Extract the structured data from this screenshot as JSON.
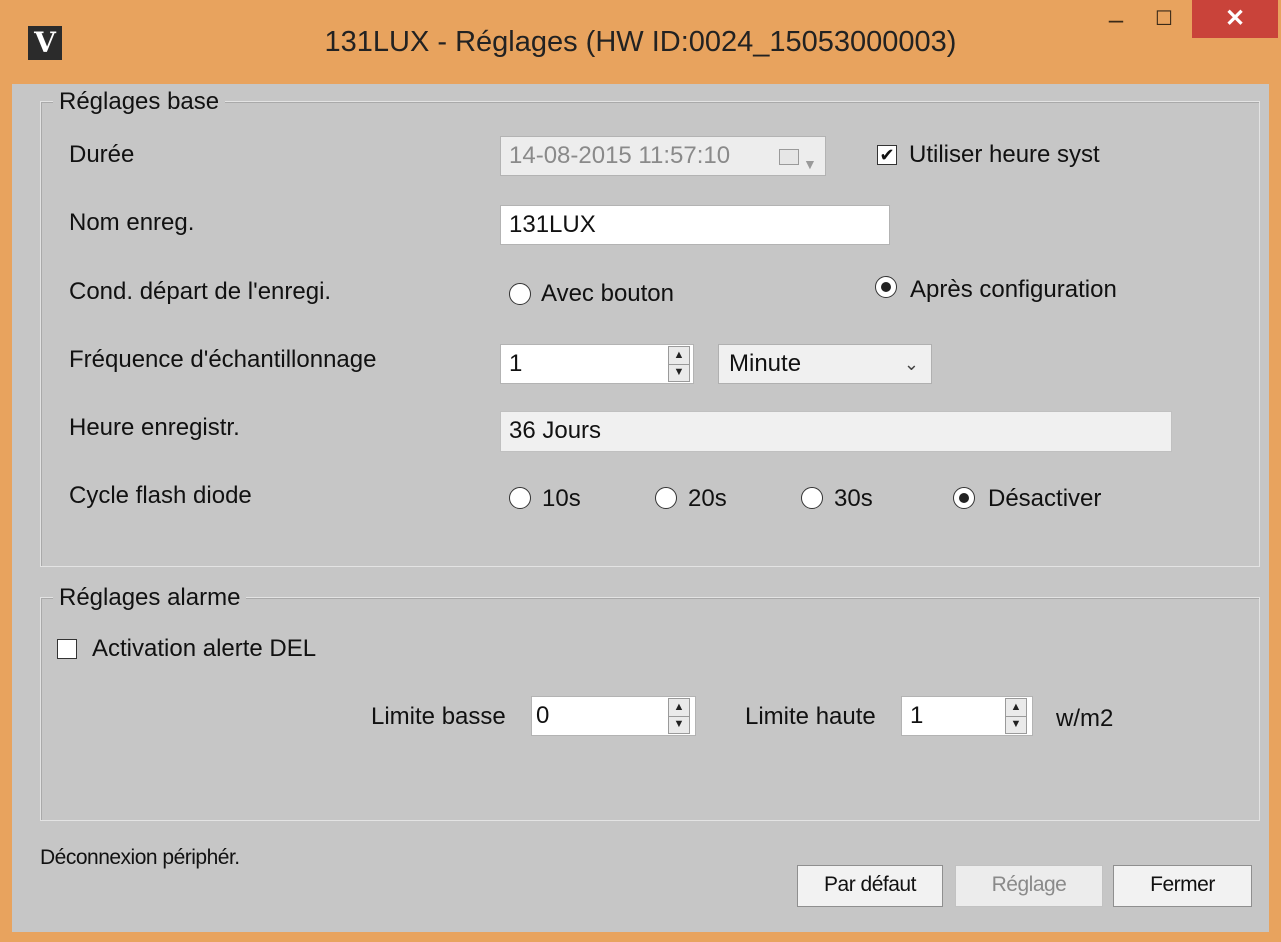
{
  "window": {
    "title": "131LUX - Réglages (HW ID:0024_15053000003)",
    "app_icon_glyph": "V",
    "minimize_glyph": "–",
    "maximize_glyph": "☐",
    "close_glyph": "✕"
  },
  "base": {
    "group_title": "Réglages base",
    "duration_label": "Durée",
    "duration_value": "14-08-2015 11:57:10",
    "use_system_time_label": "Utiliser heure syst",
    "use_system_time_checked": true,
    "name_label": "Nom enreg.",
    "name_value": "131LUX",
    "start_condition_label": "Cond. départ de l'enregi.",
    "start_with_button_label": "Avec bouton",
    "start_after_config_label": "Après configuration",
    "start_selected": "after_config",
    "sampling_label": "Fréquence d'échantillonnage",
    "sampling_value": "1",
    "sampling_unit": "Minute",
    "record_time_label": "Heure enregistr.",
    "record_time_value": "36 Jours",
    "led_cycle_label": "Cycle flash diode",
    "led_options": [
      "10s",
      "20s",
      "30s",
      "Désactiver"
    ],
    "led_selected": "Désactiver"
  },
  "alarm": {
    "group_title": "Réglages alarme",
    "led_alert_label": "Activation alerte DEL",
    "led_alert_checked": false,
    "low_limit_label": "Limite basse",
    "low_limit_value": "0",
    "high_limit_label": "Limite haute",
    "high_limit_value": "1",
    "unit": "w/m2"
  },
  "footer": {
    "status": "Déconnexion périphér.",
    "default_button": "Par défaut",
    "apply_button": "Réglage",
    "close_button": "Fermer"
  },
  "colors": {
    "title_bar": "#e8a35e",
    "client_bg": "#c6c6c6",
    "close_button": "#c9433a"
  }
}
